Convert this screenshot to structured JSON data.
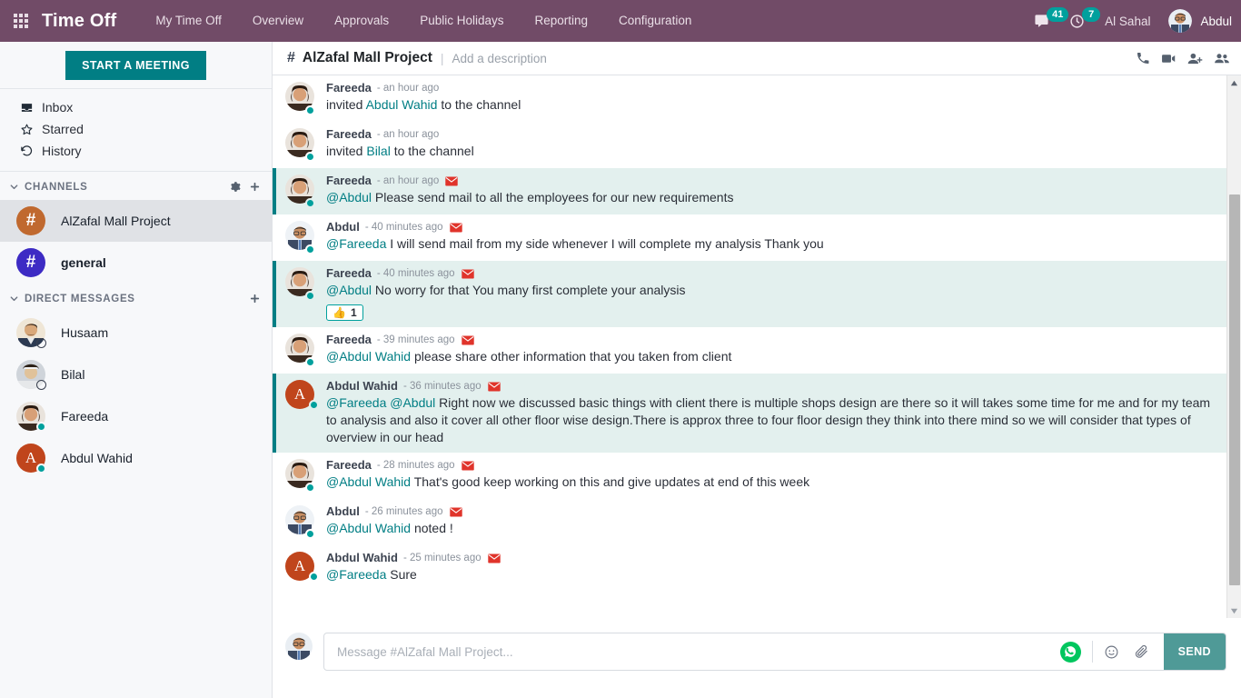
{
  "topbar": {
    "apps_icon": "apps-grid-icon",
    "brand": "Time Off",
    "nav": [
      {
        "label": "My Time Off"
      },
      {
        "label": "Overview"
      },
      {
        "label": "Approvals"
      },
      {
        "label": "Public Holidays"
      },
      {
        "label": "Reporting"
      },
      {
        "label": "Configuration"
      }
    ],
    "messages_badge": "41",
    "activities_badge": "7",
    "company": "Al Sahal",
    "user": "Abdul",
    "bg_color": "#714B67"
  },
  "sidebar": {
    "start_meeting": "START A MEETING",
    "nav_items": [
      {
        "label": "Inbox",
        "icon": "inbox-icon"
      },
      {
        "label": "Starred",
        "icon": "star-icon"
      },
      {
        "label": "History",
        "icon": "history-icon"
      }
    ],
    "channels_header": "CHANNELS",
    "channels": [
      {
        "label": "AlZafal Mall Project",
        "glyph": "#",
        "color": "#C0692F",
        "active": true,
        "bold": false
      },
      {
        "label": "general",
        "glyph": "#",
        "color": "#3D2BC4",
        "active": false,
        "bold": true
      }
    ],
    "dm_header": "DIRECT MESSAGES",
    "direct_messages": [
      {
        "label": "Husaam",
        "status": "offline",
        "avatar": "photo",
        "skin": "#d9a87a",
        "hair": "#2b2118",
        "shirt": "#2c3a52"
      },
      {
        "label": "Bilal",
        "status": "offline",
        "avatar": "photo",
        "skin": "#e0c29a",
        "hair": "#e9e9ea",
        "shirt": "#cfd4da"
      },
      {
        "label": "Fareeda",
        "status": "online",
        "avatar": "photo",
        "skin": "#d8a077",
        "hair": "#2a1b12",
        "shirt": "#3a2a20"
      },
      {
        "label": "Abdul Wahid",
        "status": "online",
        "avatar": "letter",
        "letter": "A",
        "color": "#C0451C"
      }
    ]
  },
  "channel": {
    "hash": "#",
    "title": "AlZafal Mall Project",
    "divider": "|",
    "description_placeholder": "Add a description",
    "actions": [
      "phone-icon",
      "video-icon",
      "add-person-icon",
      "members-icon"
    ]
  },
  "messages": [
    {
      "author": "Fareeda",
      "time": "- an hour ago",
      "envelope": false,
      "highlight": false,
      "avatar": "fareeda",
      "parts": [
        {
          "t": "invited ",
          "k": "plain"
        },
        {
          "t": "Abdul Wahid",
          "k": "link"
        },
        {
          "t": " to the channel",
          "k": "plain"
        }
      ]
    },
    {
      "author": "Fareeda",
      "time": "- an hour ago",
      "envelope": false,
      "highlight": false,
      "avatar": "fareeda",
      "parts": [
        {
          "t": "invited ",
          "k": "plain"
        },
        {
          "t": "Bilal",
          "k": "link"
        },
        {
          "t": " to the channel",
          "k": "plain"
        }
      ]
    },
    {
      "author": "Fareeda",
      "time": "- an hour ago",
      "envelope": true,
      "highlight": true,
      "avatar": "fareeda",
      "parts": [
        {
          "t": "@Abdul",
          "k": "mention"
        },
        {
          "t": " Please send mail to all the employees for our new requirements",
          "k": "plain"
        }
      ]
    },
    {
      "author": "Abdul",
      "time": "- 40 minutes ago",
      "envelope": true,
      "highlight": false,
      "avatar": "abdul",
      "parts": [
        {
          "t": "@Fareeda",
          "k": "mention"
        },
        {
          "t": " I will send mail from my side whenever I will complete my analysis Thank you",
          "k": "plain"
        }
      ]
    },
    {
      "author": "Fareeda",
      "time": "- 40 minutes ago",
      "envelope": true,
      "highlight": true,
      "avatar": "fareeda",
      "parts": [
        {
          "t": "@Abdul",
          "k": "mention"
        },
        {
          "t": " No worry for that You many first complete your analysis",
          "k": "plain"
        }
      ],
      "reaction": {
        "emoji": "👍",
        "count": "1"
      }
    },
    {
      "author": "Fareeda",
      "time": "- 39 minutes ago",
      "envelope": true,
      "highlight": false,
      "avatar": "fareeda",
      "parts": [
        {
          "t": "@Abdul Wahid",
          "k": "mention"
        },
        {
          "t": " please share other information that you taken from client",
          "k": "plain"
        }
      ]
    },
    {
      "author": "Abdul Wahid",
      "time": "- 36 minutes ago",
      "envelope": true,
      "highlight": true,
      "avatar": "wahid",
      "parts": [
        {
          "t": "@Fareeda",
          "k": "mention"
        },
        {
          "t": " ",
          "k": "plain"
        },
        {
          "t": "@Abdul",
          "k": "mention"
        },
        {
          "t": " Right now we discussed basic things with client there is multiple shops design are there so it will takes some time for me and for my team to analysis and also it cover all other floor wise design.There is approx three to four floor design they think into there mind so we will consider that types of overview in our head",
          "k": "plain"
        }
      ]
    },
    {
      "author": "Fareeda",
      "time": "- 28 minutes ago",
      "envelope": true,
      "highlight": false,
      "avatar": "fareeda",
      "parts": [
        {
          "t": "@Abdul Wahid",
          "k": "mention"
        },
        {
          "t": " That's good keep working on this and give updates at end of this week",
          "k": "plain"
        }
      ]
    },
    {
      "author": "Abdul",
      "time": "- 26 minutes ago",
      "envelope": true,
      "highlight": false,
      "avatar": "abdul",
      "parts": [
        {
          "t": "@Abdul Wahid",
          "k": "mention"
        },
        {
          "t": " noted !",
          "k": "plain"
        }
      ]
    },
    {
      "author": "Abdul Wahid",
      "time": "- 25 minutes ago",
      "envelope": true,
      "highlight": false,
      "avatar": "wahid",
      "parts": [
        {
          "t": "@Fareeda",
          "k": "mention"
        },
        {
          "t": " Sure",
          "k": "plain"
        }
      ]
    }
  ],
  "composer": {
    "placeholder": "Message #AlZafal Mall Project...",
    "whatsapp_icon": "whatsapp-icon",
    "emoji_icon": "emoji-icon",
    "attach_icon": "paperclip-icon",
    "send_label": "SEND"
  },
  "colors": {
    "brand_purple": "#714B67",
    "teal": "#017E84",
    "highlight_bg": "#E3F0EE",
    "badge": "#00A09D"
  }
}
